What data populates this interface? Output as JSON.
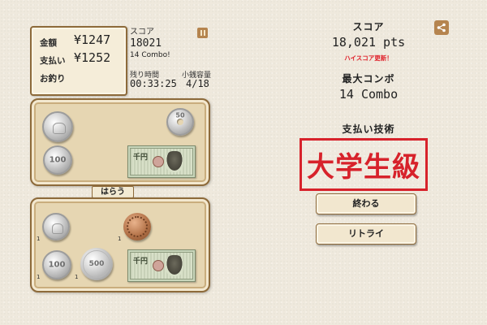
{
  "left_panel": {
    "total_label": "金額",
    "total_value": "¥1247",
    "paid_label": "支払い",
    "paid_value": "¥1252",
    "change_label": "お釣り",
    "score_label": "スコア",
    "score_value": "18021",
    "combo_text": "14 Combo!",
    "time_label": "残り時間",
    "time_value": "00:33:25",
    "capacity_label": "小銭容量",
    "capacity_value": "4/18"
  },
  "pay_button_label": "はらう",
  "top_tray": {
    "coins": [
      {
        "kind": "silver-coin-1",
        "text": ""
      },
      {
        "kind": "silver-coin-50",
        "text": "50"
      },
      {
        "kind": "silver-coin-100",
        "text": "100"
      }
    ],
    "bill": {
      "kind": "1000-yen-bill",
      "denom": "千円"
    }
  },
  "bottom_tray": {
    "counts": [
      "1",
      "1",
      "1",
      "1"
    ],
    "coins": [
      {
        "kind": "silver-coin-1",
        "text": ""
      },
      {
        "kind": "copper-coin-10",
        "text": ""
      },
      {
        "kind": "silver-coin-100",
        "text": "100"
      },
      {
        "kind": "silver-coin-500",
        "text": "500"
      }
    ],
    "bill": {
      "kind": "1000-yen-bill",
      "denom": "千円"
    }
  },
  "right_panel": {
    "score_label": "スコア",
    "score_value": "18,021 pts",
    "highscore_text": "ハイスコア更新！",
    "max_combo_label": "最大コンボ",
    "max_combo_value": "14 Combo",
    "skill_label": "支払い技術",
    "skill_rank": "大学生級",
    "end_button": "終わる",
    "retry_button": "リトライ"
  },
  "colors": {
    "background": "#efe9dd",
    "panel_border": "#8d6a3a",
    "stamp_red": "#d7222b",
    "highscore_red": "#e0202a"
  },
  "icons": [
    "pause-icon",
    "share-icon"
  ]
}
